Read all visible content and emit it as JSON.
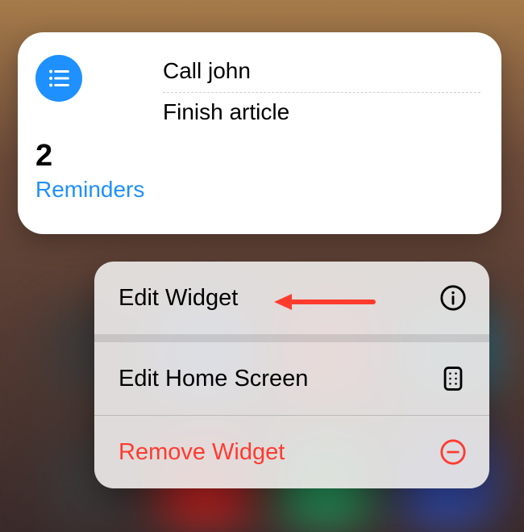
{
  "widget": {
    "count": "2",
    "title": "Reminders",
    "items": [
      {
        "label": "Call john"
      },
      {
        "label": "Finish article"
      }
    ]
  },
  "menu": {
    "edit_widget": {
      "label": "Edit Widget"
    },
    "edit_home": {
      "label": "Edit Home Screen"
    },
    "remove": {
      "label": "Remove Widget"
    }
  },
  "colors": {
    "accent": "#1e90ff",
    "destructive": "#ff3b30"
  }
}
